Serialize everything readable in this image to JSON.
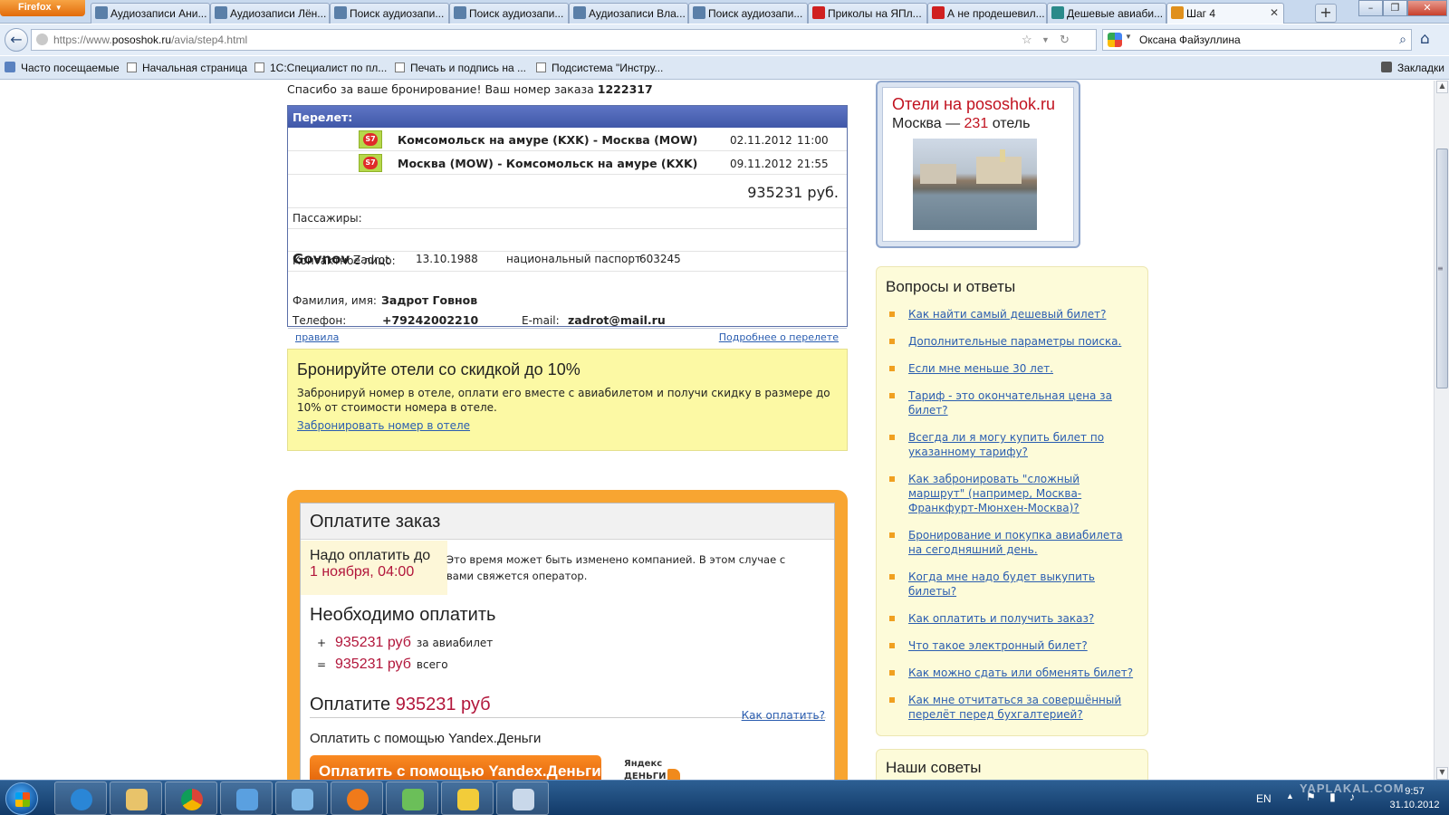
{
  "browser": {
    "menu_button": "Firefox",
    "tabs": [
      {
        "label": "Аудиозаписи Ани...",
        "icon": "vk-icon",
        "color": "#5a7fa8"
      },
      {
        "label": "Аудиозаписи Лён...",
        "icon": "vk-icon",
        "color": "#5a7fa8"
      },
      {
        "label": "Поиск аудиозапи...",
        "icon": "vk-icon",
        "color": "#5a7fa8"
      },
      {
        "label": "Поиск аудиозапи...",
        "icon": "vk-icon",
        "color": "#5a7fa8"
      },
      {
        "label": "Аудиозаписи Вла...",
        "icon": "vk-icon",
        "color": "#5a7fa8"
      },
      {
        "label": "Поиск аудиозапи...",
        "icon": "vk-icon",
        "color": "#5a7fa8"
      },
      {
        "label": "Приколы на ЯПл...",
        "icon": "yaplakal-icon",
        "color": "#d02020"
      },
      {
        "label": "А не продешевил...",
        "icon": "yaplakal-icon",
        "color": "#d02020"
      },
      {
        "label": "Дешевые авиаби...",
        "icon": "plane-icon",
        "color": "#2a8a8a"
      },
      {
        "label": "Шаг 4",
        "icon": "pososhok-icon",
        "color": "#e0901c",
        "active": true
      }
    ],
    "new_tab": "+",
    "url_prefix": "https://www.",
    "url_host": "pososhok.ru",
    "url_path": "/avia/step4.html",
    "search_value": "Оксана Файзуллина",
    "bookmarks": [
      "Часто посещаемые",
      "Начальная страница",
      "1С:Специалист по пл...",
      "Печать и подпись на ...",
      "Подсистема \"Инстру..."
    ],
    "bookmarks_menu": "Закладки"
  },
  "order": {
    "thanks_text": "Спасибо за ваше бронирование! Ваш номер заказа",
    "order_number": "1222317",
    "flight_header": "Перелет:",
    "segments": [
      {
        "airline_logo": "s7-logo-icon",
        "airline_mark": "S7",
        "route": "Комсомольск на амуре (KXK) - Москва (MOW)",
        "date": "02.11.2012",
        "time": "11:00"
      },
      {
        "airline_logo": "s7-logo-icon",
        "airline_mark": "S7",
        "route": "Москва (MOW) - Комсомольск на амуре (KXK)",
        "date": "09.11.2012",
        "time": "21:55"
      }
    ],
    "price": "935231 руб.",
    "passengers_label": "Пассажиры:",
    "passenger": {
      "surname": "Govnov",
      "name": "Zadrot",
      "birth_date": "13.10.1988",
      "document": "национальный паспорт",
      "document_number": "603245"
    },
    "contact_label": "Контактное лицо:",
    "contact_name_label": "Фамилия, имя:",
    "contact_name": "Задрот Говнов",
    "phone_label": "Телефон:",
    "phone": "+79242002210",
    "email_label": "E-mail:",
    "email": "zadrot@mail.ru",
    "rules_link": "правила",
    "details_link": "Подробнее о перелете"
  },
  "hotel_promo": {
    "title": "Бронируйте отели со скидкой до 10%",
    "text": "Забронируй номер в отеле, оплати его вместе с авиабилетом и получи скидку в размере до 10% от стоимости номера в отеле.",
    "link": "Забронировать номер в отеле"
  },
  "payment": {
    "title": "Оплатите заказ",
    "deadline_label": "Надо оплатить до",
    "deadline_value": "1 ноября, 04:00",
    "deadline_note": "Это время может быть изменено компанией. В этом случае с вами свяжется оператор.",
    "need_title": "Необходимо оплатить",
    "rows": [
      {
        "op": "+",
        "amount": "935231 руб",
        "desc": "за авиабилет"
      },
      {
        "op": "=",
        "amount": "935231 руб",
        "desc": "всего"
      }
    ],
    "total_label": "Оплатите",
    "total_amount": "935231 руб",
    "how_link": "Как оплатить?",
    "method_label": "Оплатить с помощью Yandex.Деньги",
    "method_button": "Оплатить с помощью Yandex.Деньги",
    "ym_logo_line1": "Яндекс",
    "ym_logo_line2": "ДЕНЬГИ"
  },
  "sidebar": {
    "hotels_title": "Отели на pososhok.ru",
    "hotels_city": "Москва —",
    "hotels_count": "231",
    "hotels_unit": "отель",
    "faq_title": "Вопросы и ответы",
    "faq": [
      "Как найти самый дешевый билет?",
      "Дополнительные параметры поиска.",
      "Если мне меньше 30 лет.",
      "Тариф - это окончательная цена за билет?",
      "Всегда ли я могу купить билет по указанному тарифу?",
      "Как забронировать \"сложный маршрут\" (например, Москва-Франкфурт-Мюнхен-Москва)?",
      "Бронирование и покупка авиабилета на сегодняшний день.",
      "Когда мне надо будет выкупить билеты?",
      "Как оплатить и получить заказ?",
      "Что такое электронный билет?",
      "Как можно сдать или обменять билет?",
      "Как мне отчитаться за совершённый перелёт перед бухгалтерией?"
    ],
    "tips_title": "Наши советы"
  },
  "taskbar": {
    "apps": [
      "ie-icon",
      "explorer-icon",
      "chrome-icon",
      "network-icon",
      "photo-viewer-icon",
      "firefox-icon",
      "recycle-icon",
      "yellow-app-icon",
      "paint-icon"
    ],
    "language": "EN",
    "time": "9:57",
    "date": "31.10.2012",
    "watermark": "YAPLAKAL.COM"
  },
  "colors": {
    "accent_red": "#b2163b",
    "orange": "#f8a531",
    "link": "#2a5db0",
    "header_blue": "#3f57a8"
  }
}
